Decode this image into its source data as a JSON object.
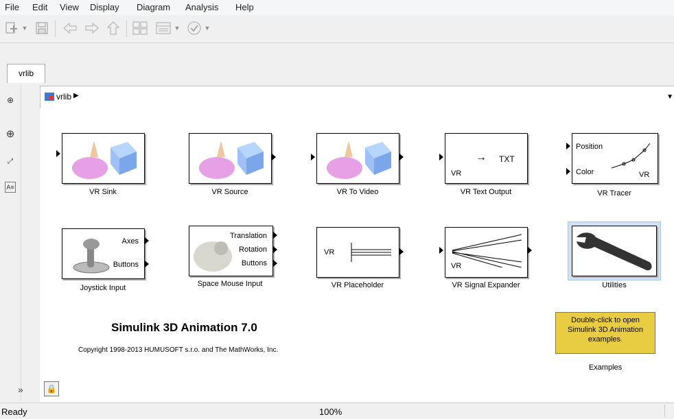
{
  "menu": [
    "File",
    "Edit",
    "View",
    "Display",
    "Diagram",
    "Analysis",
    "Help"
  ],
  "tab": {
    "label": "vrlib"
  },
  "address": {
    "path": "vrlib"
  },
  "blocks": {
    "vr_sink": {
      "label": "VR Sink"
    },
    "vr_source": {
      "label": "VR Source"
    },
    "vr_to_video": {
      "label": "VR To Video"
    },
    "vr_text_output": {
      "label": "VR Text Output",
      "inner_vr": "VR",
      "inner_txt": "TXT"
    },
    "vr_tracer": {
      "label": "VR Tracer",
      "port_position": "Position",
      "port_color": "Color",
      "inner_vr": "VR"
    },
    "joystick": {
      "label": "Joystick Input",
      "port_axes": "Axes",
      "port_buttons": "Buttons"
    },
    "space_mouse": {
      "label": "Space Mouse Input",
      "port_translation": "Translation",
      "port_rotation": "Rotation",
      "port_buttons": "Buttons"
    },
    "vr_placeholder": {
      "label": "VR Placeholder",
      "inner_vr": "VR"
    },
    "vr_signal_expander": {
      "label": "VR Signal Expander",
      "inner_vr": "VR"
    },
    "utilities": {
      "label": "Utilities"
    },
    "examples": {
      "label": "Examples",
      "text": "Double-click to open Simulink 3D Animation examples."
    }
  },
  "title": "Simulink 3D Animation 7.0",
  "copyright": "Copyright 1998-2013 HUMUSOFT s.r.o. and The MathWorks, Inc.",
  "status": {
    "left": "Ready",
    "zoom": "100%"
  },
  "colors": {
    "examples_bg": "#e8cd42",
    "utilities_highlight": "#cfe0f5"
  }
}
